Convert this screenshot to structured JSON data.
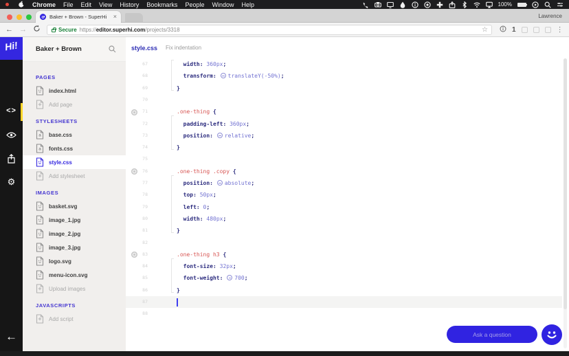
{
  "colors": {
    "brand_blue": "#3427e0",
    "accent_yellow": "#ffd629",
    "selector_red": "#d75452",
    "property_navy": "#2b2b7e",
    "value_periwinkle": "#7373d2",
    "secure_green": "#188038"
  },
  "menubar": {
    "apple_icon": "apple",
    "items": [
      "Chrome",
      "File",
      "Edit",
      "View",
      "History",
      "Bookmarks",
      "People",
      "Window",
      "Help"
    ],
    "status_icons": [
      "phone",
      "camera",
      "display",
      "droplet",
      "info-circle",
      "q-circle",
      "plus-cross",
      "share",
      "bluetooth",
      "wifi",
      "airplay-display"
    ],
    "battery_label": "100%",
    "right_icons": [
      "play-circle",
      "search",
      "menu-lines"
    ]
  },
  "browser": {
    "tab": {
      "title": "Baker + Brown - SuperHi",
      "close_glyph": "×"
    },
    "profile_name": "Lawrence",
    "toolbar": {
      "back_glyph": "←",
      "forward_glyph": "→",
      "reload_icon": "reload",
      "url": {
        "secure_label": "Secure",
        "scheme": "https://",
        "host": "editor.superhi.com",
        "path": "/projects/3318"
      },
      "star_glyph": "☆",
      "onepassword_label": "1",
      "muted_extensions": [
        "ext-a",
        "ext-b",
        "ext-c"
      ],
      "menu_glyph": "⋮"
    }
  },
  "rail": {
    "logo_text": "Hi!",
    "gear_glyph": "⚙",
    "code_glyph": "<>",
    "back_glyph": "←",
    "icons": [
      "code",
      "eye",
      "share-box",
      "gear"
    ],
    "active_icon": "code"
  },
  "sidebar": {
    "project_title": "Baker + Brown",
    "search_icon": "search",
    "sections": [
      {
        "label": "PAGES",
        "items": [
          {
            "name": "index.html",
            "icon": "smiley"
          },
          {
            "name": "Add page",
            "icon": "plus",
            "muted": true
          }
        ]
      },
      {
        "label": "STYLESHEETS",
        "items": [
          {
            "name": "base.css",
            "icon": "letter"
          },
          {
            "name": "fonts.css",
            "icon": "letter"
          },
          {
            "name": "style.css",
            "icon": "smiley",
            "selected": true
          },
          {
            "name": "Add stylesheet",
            "icon": "plus",
            "muted": true
          }
        ]
      },
      {
        "label": "IMAGES",
        "items": [
          {
            "name": "basket.svg",
            "icon": "smiley"
          },
          {
            "name": "image_1.jpg",
            "icon": "smiley"
          },
          {
            "name": "image_2.jpg",
            "icon": "smiley"
          },
          {
            "name": "image_3.jpg",
            "icon": "smiley"
          },
          {
            "name": "logo.svg",
            "icon": "smiley"
          },
          {
            "name": "menu-icon.svg",
            "icon": "smiley"
          },
          {
            "name": "Upload images",
            "icon": "plus",
            "muted": true
          }
        ]
      },
      {
        "label": "JAVASCRIPTS",
        "items": [
          {
            "name": "Add script",
            "icon": "plus",
            "muted": true
          }
        ]
      }
    ]
  },
  "editor": {
    "filename": "style.css",
    "action_label": "Fix indentation",
    "ask_button_label": "Ask a question",
    "chat_icon": "smiley",
    "lines": [
      {
        "n": "67",
        "ind": 1,
        "tokens": [
          [
            "prop",
            "width"
          ],
          [
            "punc",
            ": "
          ],
          [
            "val",
            "360px"
          ],
          [
            "punc",
            ";"
          ]
        ]
      },
      {
        "n": "68",
        "ind": 1,
        "tokens": [
          [
            "prop",
            "transform"
          ],
          [
            "punc",
            ": "
          ],
          [
            "dd",
            ""
          ],
          [
            "val",
            "translateY(-50%)"
          ],
          [
            "punc",
            ";"
          ]
        ]
      },
      {
        "n": "69",
        "ind": 0,
        "tokens": [
          [
            "punc",
            "}"
          ]
        ]
      },
      {
        "n": "70",
        "ind": 0,
        "tokens": []
      },
      {
        "n": "71",
        "ind": 0,
        "dot": true,
        "tokens": [
          [
            "sel",
            ".one-thing"
          ],
          [
            "punc",
            " {"
          ]
        ]
      },
      {
        "n": "72",
        "ind": 1,
        "tokens": [
          [
            "prop",
            "padding-left"
          ],
          [
            "punc",
            ": "
          ],
          [
            "val",
            "360px"
          ],
          [
            "punc",
            ";"
          ]
        ]
      },
      {
        "n": "73",
        "ind": 1,
        "tokens": [
          [
            "prop",
            "position"
          ],
          [
            "punc",
            ": "
          ],
          [
            "dd",
            ""
          ],
          [
            "val",
            "relative"
          ],
          [
            "punc",
            ";"
          ]
        ]
      },
      {
        "n": "74",
        "ind": 0,
        "tokens": [
          [
            "punc",
            "}"
          ]
        ]
      },
      {
        "n": "75",
        "ind": 0,
        "tokens": []
      },
      {
        "n": "76",
        "ind": 0,
        "dot": true,
        "tokens": [
          [
            "sel",
            ".one-thing .copy"
          ],
          [
            "punc",
            " {"
          ]
        ]
      },
      {
        "n": "77",
        "ind": 1,
        "tokens": [
          [
            "prop",
            "position"
          ],
          [
            "punc",
            ": "
          ],
          [
            "dd",
            ""
          ],
          [
            "val",
            "absolute"
          ],
          [
            "punc",
            ";"
          ]
        ]
      },
      {
        "n": "78",
        "ind": 1,
        "tokens": [
          [
            "prop",
            "top"
          ],
          [
            "punc",
            ": "
          ],
          [
            "val",
            "50px"
          ],
          [
            "punc",
            ";"
          ]
        ]
      },
      {
        "n": "79",
        "ind": 1,
        "tokens": [
          [
            "prop",
            "left"
          ],
          [
            "punc",
            ": "
          ],
          [
            "val",
            "0"
          ],
          [
            "punc",
            ";"
          ]
        ]
      },
      {
        "n": "80",
        "ind": 1,
        "tokens": [
          [
            "prop",
            "width"
          ],
          [
            "punc",
            ": "
          ],
          [
            "val",
            "480px"
          ],
          [
            "punc",
            ";"
          ]
        ]
      },
      {
        "n": "81",
        "ind": 0,
        "tokens": [
          [
            "punc",
            "}"
          ]
        ]
      },
      {
        "n": "82",
        "ind": 0,
        "tokens": []
      },
      {
        "n": "83",
        "ind": 0,
        "dot": true,
        "tokens": [
          [
            "sel",
            ".one-thing h3"
          ],
          [
            "punc",
            " {"
          ]
        ]
      },
      {
        "n": "84",
        "ind": 1,
        "tokens": [
          [
            "prop",
            "font-size"
          ],
          [
            "punc",
            ": "
          ],
          [
            "val",
            "32px"
          ],
          [
            "punc",
            ";"
          ]
        ]
      },
      {
        "n": "85",
        "ind": 1,
        "tokens": [
          [
            "prop",
            "font-weight"
          ],
          [
            "punc",
            ": "
          ],
          [
            "dd",
            ""
          ],
          [
            "val",
            "700"
          ],
          [
            "punc",
            ";"
          ]
        ]
      },
      {
        "n": "86",
        "ind": 0,
        "tokens": [
          [
            "punc",
            "}"
          ]
        ]
      },
      {
        "n": "87",
        "ind": 0,
        "cursor": true,
        "tokens": []
      },
      {
        "n": "88",
        "ind": 0,
        "tokens": []
      }
    ],
    "blocks": [
      {
        "start": 67,
        "end": 69,
        "openAbove": true
      },
      {
        "start": 71,
        "end": 74
      },
      {
        "start": 76,
        "end": 81
      },
      {
        "start": 83,
        "end": 86
      }
    ]
  }
}
